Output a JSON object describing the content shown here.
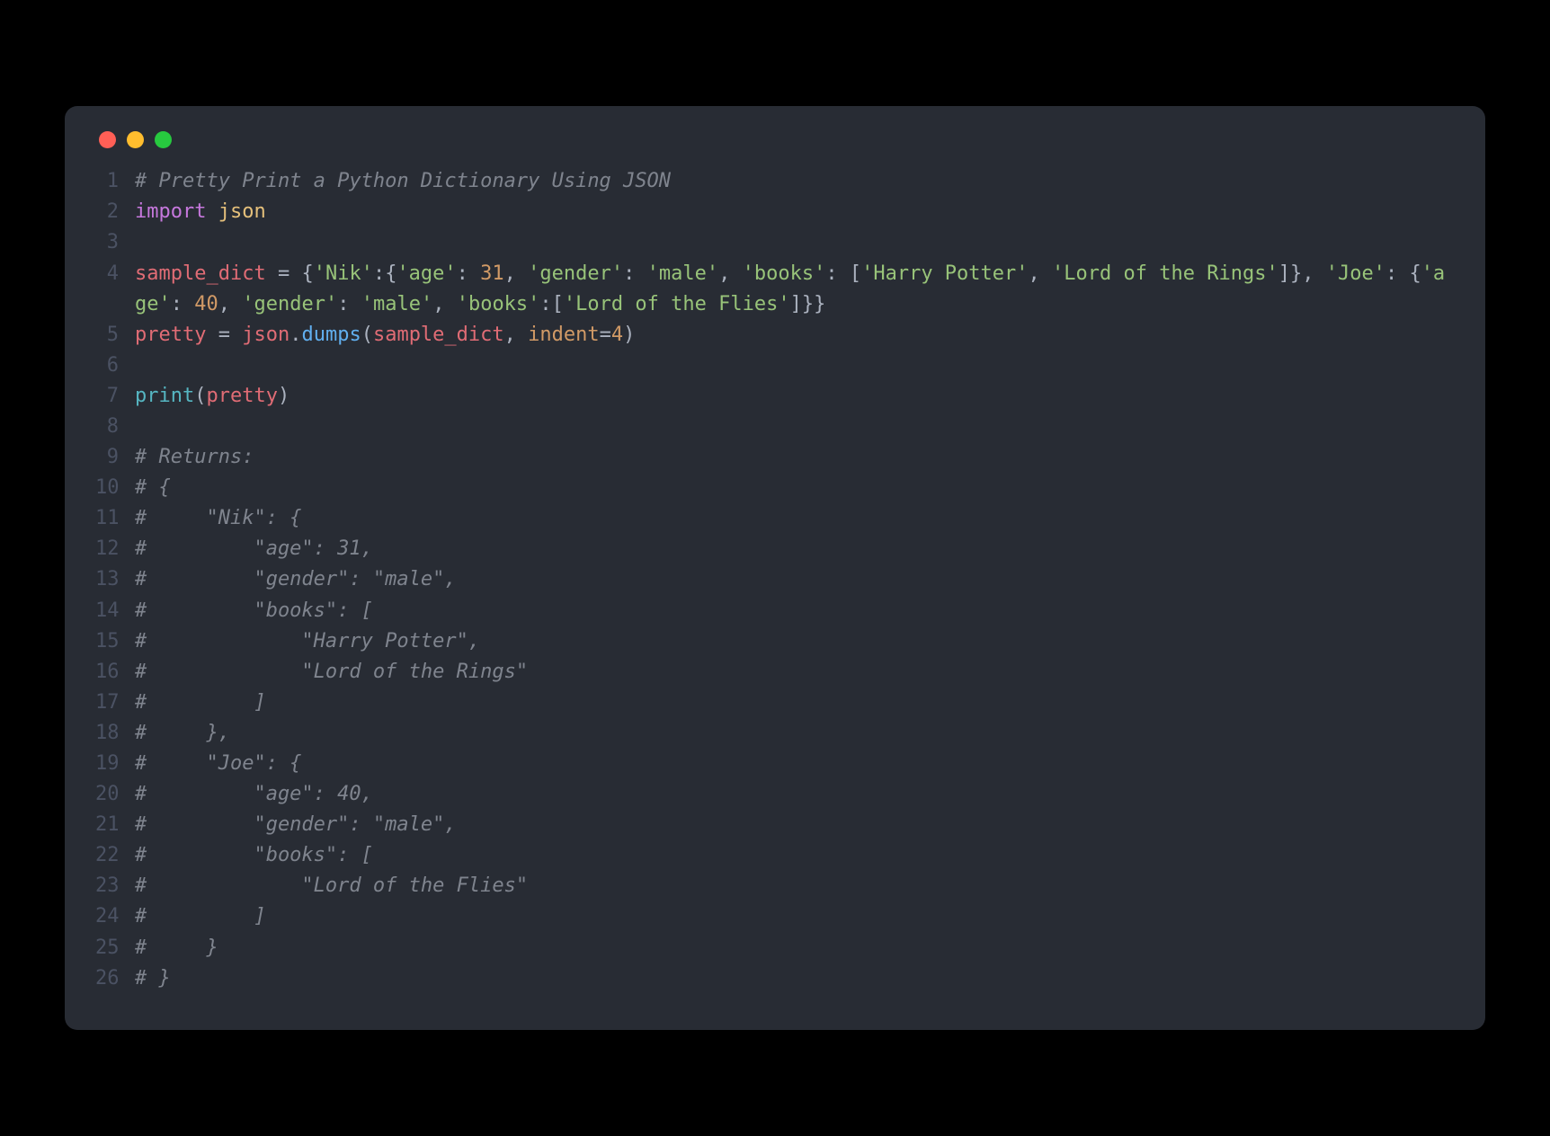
{
  "window": {
    "traffic_lights": [
      "red",
      "yellow",
      "green"
    ]
  },
  "code": {
    "lines": [
      {
        "n": "1",
        "tokens": [
          {
            "c": "tok-comment",
            "t": "# Pretty Print a Python Dictionary Using JSON"
          }
        ]
      },
      {
        "n": "2",
        "tokens": [
          {
            "c": "tok-keyword",
            "t": "import"
          },
          {
            "c": "tok-op",
            "t": " "
          },
          {
            "c": "tok-module",
            "t": "json"
          }
        ]
      },
      {
        "n": "3",
        "tokens": [
          {
            "c": "tok-op",
            "t": ""
          }
        ]
      },
      {
        "n": "4",
        "tokens": [
          {
            "c": "tok-var",
            "t": "sample_dict"
          },
          {
            "c": "tok-op",
            "t": " "
          },
          {
            "c": "tok-op",
            "t": "="
          },
          {
            "c": "tok-op",
            "t": " "
          },
          {
            "c": "tok-punct",
            "t": "{"
          },
          {
            "c": "tok-string",
            "t": "'Nik'"
          },
          {
            "c": "tok-punct",
            "t": ":"
          },
          {
            "c": "tok-punct",
            "t": "{"
          },
          {
            "c": "tok-string",
            "t": "'age'"
          },
          {
            "c": "tok-punct",
            "t": ": "
          },
          {
            "c": "tok-number",
            "t": "31"
          },
          {
            "c": "tok-punct",
            "t": ", "
          },
          {
            "c": "tok-string",
            "t": "'gender'"
          },
          {
            "c": "tok-punct",
            "t": ": "
          },
          {
            "c": "tok-string",
            "t": "'male'"
          },
          {
            "c": "tok-punct",
            "t": ", "
          },
          {
            "c": "tok-string",
            "t": "'books'"
          },
          {
            "c": "tok-punct",
            "t": ": ["
          },
          {
            "c": "tok-string",
            "t": "'Harry Potter'"
          },
          {
            "c": "tok-punct",
            "t": ", "
          },
          {
            "c": "tok-string",
            "t": "'Lord of the Rings'"
          },
          {
            "c": "tok-punct",
            "t": "]}"
          },
          {
            "c": "tok-punct",
            "t": ", "
          },
          {
            "c": "tok-string",
            "t": "'Joe'"
          },
          {
            "c": "tok-punct",
            "t": ": "
          },
          {
            "c": "tok-punct",
            "t": "{"
          },
          {
            "c": "tok-string",
            "t": "'age'"
          },
          {
            "c": "tok-punct",
            "t": ": "
          },
          {
            "c": "tok-number",
            "t": "40"
          },
          {
            "c": "tok-punct",
            "t": ", "
          },
          {
            "c": "tok-string",
            "t": "'gender'"
          },
          {
            "c": "tok-punct",
            "t": ": "
          },
          {
            "c": "tok-string",
            "t": "'male'"
          },
          {
            "c": "tok-punct",
            "t": ", "
          },
          {
            "c": "tok-string",
            "t": "'books'"
          },
          {
            "c": "tok-punct",
            "t": ":["
          },
          {
            "c": "tok-string",
            "t": "'Lord of the Flies'"
          },
          {
            "c": "tok-punct",
            "t": "]}}"
          }
        ]
      },
      {
        "n": "5",
        "tokens": [
          {
            "c": "tok-var",
            "t": "pretty"
          },
          {
            "c": "tok-op",
            "t": " = "
          },
          {
            "c": "tok-var",
            "t": "json"
          },
          {
            "c": "tok-punct",
            "t": "."
          },
          {
            "c": "tok-func",
            "t": "dumps"
          },
          {
            "c": "tok-punct",
            "t": "("
          },
          {
            "c": "tok-var",
            "t": "sample_dict"
          },
          {
            "c": "tok-punct",
            "t": ", "
          },
          {
            "c": "tok-param",
            "t": "indent"
          },
          {
            "c": "tok-op",
            "t": "="
          },
          {
            "c": "tok-number",
            "t": "4"
          },
          {
            "c": "tok-punct",
            "t": ")"
          }
        ]
      },
      {
        "n": "6",
        "tokens": [
          {
            "c": "tok-op",
            "t": ""
          }
        ]
      },
      {
        "n": "7",
        "tokens": [
          {
            "c": "tok-builtin",
            "t": "print"
          },
          {
            "c": "tok-punct",
            "t": "("
          },
          {
            "c": "tok-var",
            "t": "pretty"
          },
          {
            "c": "tok-punct",
            "t": ")"
          }
        ]
      },
      {
        "n": "8",
        "tokens": [
          {
            "c": "tok-op",
            "t": ""
          }
        ]
      },
      {
        "n": "9",
        "tokens": [
          {
            "c": "tok-comment",
            "t": "# Returns:"
          }
        ]
      },
      {
        "n": "10",
        "tokens": [
          {
            "c": "tok-comment",
            "t": "# {"
          }
        ]
      },
      {
        "n": "11",
        "tokens": [
          {
            "c": "tok-comment",
            "t": "#     \"Nik\": {"
          }
        ]
      },
      {
        "n": "12",
        "tokens": [
          {
            "c": "tok-comment",
            "t": "#         \"age\": 31,"
          }
        ]
      },
      {
        "n": "13",
        "tokens": [
          {
            "c": "tok-comment",
            "t": "#         \"gender\": \"male\","
          }
        ]
      },
      {
        "n": "14",
        "tokens": [
          {
            "c": "tok-comment",
            "t": "#         \"books\": ["
          }
        ]
      },
      {
        "n": "15",
        "tokens": [
          {
            "c": "tok-comment",
            "t": "#             \"Harry Potter\","
          }
        ]
      },
      {
        "n": "16",
        "tokens": [
          {
            "c": "tok-comment",
            "t": "#             \"Lord of the Rings\""
          }
        ]
      },
      {
        "n": "17",
        "tokens": [
          {
            "c": "tok-comment",
            "t": "#         ]"
          }
        ]
      },
      {
        "n": "18",
        "tokens": [
          {
            "c": "tok-comment",
            "t": "#     },"
          }
        ]
      },
      {
        "n": "19",
        "tokens": [
          {
            "c": "tok-comment",
            "t": "#     \"Joe\": {"
          }
        ]
      },
      {
        "n": "20",
        "tokens": [
          {
            "c": "tok-comment",
            "t": "#         \"age\": 40,"
          }
        ]
      },
      {
        "n": "21",
        "tokens": [
          {
            "c": "tok-comment",
            "t": "#         \"gender\": \"male\","
          }
        ]
      },
      {
        "n": "22",
        "tokens": [
          {
            "c": "tok-comment",
            "t": "#         \"books\": ["
          }
        ]
      },
      {
        "n": "23",
        "tokens": [
          {
            "c": "tok-comment",
            "t": "#             \"Lord of the Flies\""
          }
        ]
      },
      {
        "n": "24",
        "tokens": [
          {
            "c": "tok-comment",
            "t": "#         ]"
          }
        ]
      },
      {
        "n": "25",
        "tokens": [
          {
            "c": "tok-comment",
            "t": "#     }"
          }
        ]
      },
      {
        "n": "26",
        "tokens": [
          {
            "c": "tok-comment",
            "t": "# }"
          }
        ]
      }
    ]
  }
}
